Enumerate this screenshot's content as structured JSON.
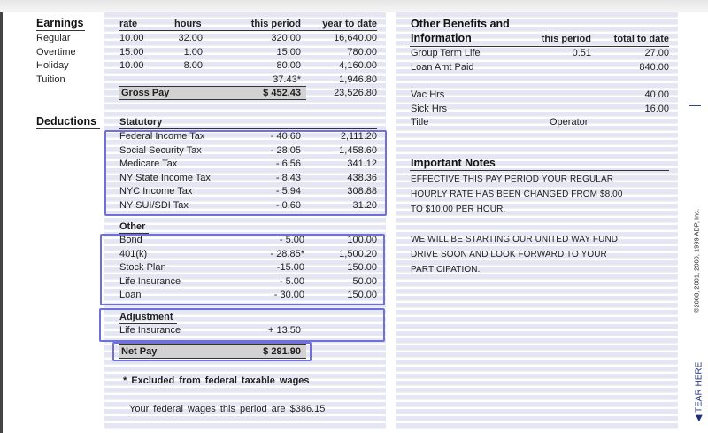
{
  "earnings": {
    "title": "Earnings",
    "headers": {
      "rate": "rate",
      "hours": "hours",
      "this_period": "this period",
      "year_to_date": "year to date"
    },
    "rows": [
      {
        "label": "Regular",
        "rate": "10.00",
        "hours": "32.00",
        "this_period": "320.00",
        "ytd": "16,640.00"
      },
      {
        "label": "Overtime",
        "rate": "15.00",
        "hours": "1.00",
        "this_period": "15.00",
        "ytd": "780.00"
      },
      {
        "label": "Holiday",
        "rate": "10.00",
        "hours": "8.00",
        "this_period": "80.00",
        "ytd": "4,160.00"
      },
      {
        "label": "Tuition",
        "rate": "",
        "hours": "",
        "this_period": "37.43*",
        "ytd": "1,946.80"
      }
    ],
    "gross_pay": {
      "label": "Gross Pay",
      "this_period": "$ 452.43",
      "ytd": "23,526.80"
    }
  },
  "deductions": {
    "title": "Deductions",
    "statutory": {
      "title": "Statutory",
      "rows": [
        {
          "label": "Federal Income Tax",
          "this_period": "- 40.60",
          "ytd": "2,111.20"
        },
        {
          "label": "Social Security Tax",
          "this_period": "- 28.05",
          "ytd": "1,458.60"
        },
        {
          "label": "Medicare Tax",
          "this_period": "- 6.56",
          "ytd": "341.12"
        },
        {
          "label": "NY State Income Tax",
          "this_period": "- 8.43",
          "ytd": "438.36"
        },
        {
          "label": "NYC Income Tax",
          "this_period": "- 5.94",
          "ytd": "308.88"
        },
        {
          "label": "NY SUI/SDI Tax",
          "this_period": "- 0.60",
          "ytd": "31.20"
        }
      ]
    },
    "other": {
      "title": "Other",
      "rows": [
        {
          "label": "Bond",
          "this_period": "- 5.00",
          "ytd": "100.00"
        },
        {
          "label": "401(k)",
          "this_period": "- 28.85*",
          "ytd": "1,500.20"
        },
        {
          "label": "Stock Plan",
          "this_period": "-15.00",
          "ytd": "150.00"
        },
        {
          "label": "Life Insurance",
          "this_period": "- 5.00",
          "ytd": "50.00"
        },
        {
          "label": "Loan",
          "this_period": "- 30.00",
          "ytd": "150.00"
        }
      ]
    },
    "adjustment": {
      "title": "Adjustment",
      "rows": [
        {
          "label": "Life Insurance",
          "this_period": "+ 13.50"
        }
      ]
    },
    "net_pay": {
      "label": "Net Pay",
      "this_period": "$ 291.90"
    }
  },
  "footnote": {
    "excluded": "* Excluded from federal taxable wages",
    "federal_wages": "Your federal wages this period are $386.15"
  },
  "benefits": {
    "title_line1": "Other Benefits and",
    "title_line2": "Information",
    "headers": {
      "this_period": "this period",
      "total_to_date": "total to date"
    },
    "rows": [
      {
        "label": "Group Term Life",
        "this_period": "0.51",
        "total": "27.00"
      },
      {
        "label": "Loan Amt Paid",
        "this_period": "",
        "total": "840.00"
      }
    ],
    "rows2": [
      {
        "label": "Vac Hrs",
        "total": "40.00"
      },
      {
        "label": "Sick Hrs",
        "total": "16.00"
      }
    ],
    "title_row": {
      "label": "Title",
      "value": "Operator"
    }
  },
  "notes": {
    "title": "Important Notes",
    "lines": [
      "EFFECTIVE THIS PAY PERIOD YOUR REGULAR",
      "HOURLY RATE HAS BEEN CHANGED FROM $8.00",
      "TO $10.00 PER HOUR.",
      "WE WILL BE STARTING OUR UNITED WAY FUND",
      "DRIVE SOON AND LOOK FORWARD TO YOUR",
      "PARTICIPATION."
    ]
  },
  "side": {
    "copyright": "©2008, 2001, 2000, 1999 ADP, Inc.",
    "tear_here": "◀ TEAR HERE"
  },
  "colors": {
    "stripe": "#e5e6f3",
    "highlight": "#6f71d8",
    "gross_fill": "#d2d2d2"
  }
}
